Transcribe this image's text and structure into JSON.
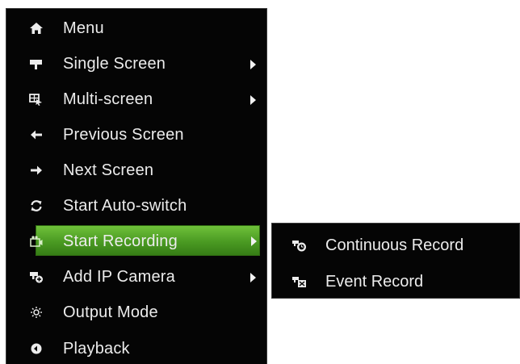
{
  "menu": {
    "items": [
      {
        "label": "Menu",
        "icon": "home-icon",
        "has_submenu": false
      },
      {
        "label": "Single Screen",
        "icon": "camera-icon",
        "has_submenu": true
      },
      {
        "label": "Multi-screen",
        "icon": "multi-screen-icon",
        "has_submenu": true
      },
      {
        "label": "Previous Screen",
        "icon": "arrow-left-icon",
        "has_submenu": false
      },
      {
        "label": "Next Screen",
        "icon": "arrow-right-icon",
        "has_submenu": false
      },
      {
        "label": "Start Auto-switch",
        "icon": "refresh-icon",
        "has_submenu": false
      },
      {
        "label": "Start Recording",
        "icon": "recording-icon",
        "has_submenu": true,
        "selected": true
      },
      {
        "label": "Add IP Camera",
        "icon": "add-ip-camera-icon",
        "has_submenu": true
      },
      {
        "label": "Output Mode",
        "icon": "output-mode-icon",
        "has_submenu": false
      },
      {
        "label": "Playback",
        "icon": "playback-icon",
        "has_submenu": false
      }
    ]
  },
  "submenu": {
    "items": [
      {
        "label": "Continuous Record",
        "icon": "continuous-record-icon"
      },
      {
        "label": "Event Record",
        "icon": "event-record-icon"
      }
    ]
  },
  "colors": {
    "menu_bg": "#050505",
    "text": "#ececec",
    "selected_top": "#6fc13a",
    "selected_bottom": "#367d16"
  }
}
